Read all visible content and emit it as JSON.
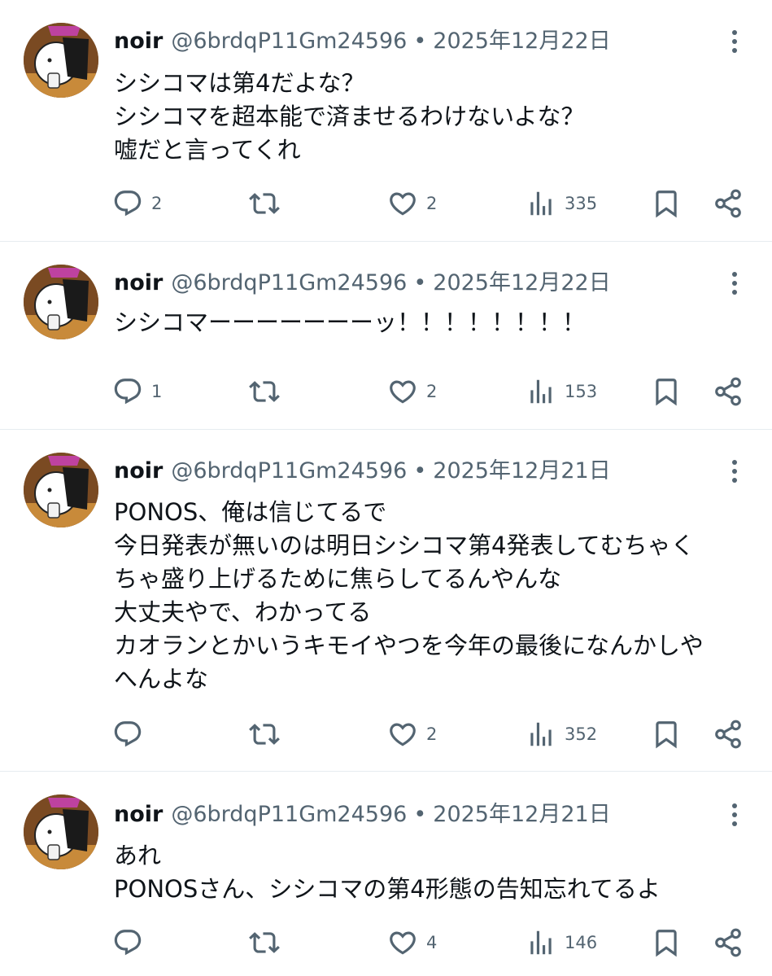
{
  "tweets": [
    {
      "name": "noir",
      "handle": "@6brdqP11Gm24596",
      "separator": "•",
      "date": "2025年12月22日",
      "lines": [
        "シシコマは第4だよな？",
        "シシコマを超本能で済ませるわけないよな？",
        "嘘だと言ってくれ"
      ],
      "replies": "2",
      "retweets": "",
      "likes": "2",
      "views": "335"
    },
    {
      "name": "noir",
      "handle": "@6brdqP11Gm24596",
      "separator": "•",
      "date": "2025年12月22日",
      "lines": [
        "シシコマーーーーーーーッ！！！！！！！！"
      ],
      "replies": "1",
      "retweets": "",
      "likes": "2",
      "views": "153"
    },
    {
      "name": "noir",
      "handle": "@6brdqP11Gm24596",
      "separator": "•",
      "date": "2025年12月21日",
      "lines": [
        "PONOS、俺は信じてるで",
        "今日発表が無いのは明日シシコマ第4発表してむちゃく",
        "ちゃ盛り上げるために焦らしてるんやんな",
        "大丈夫やで、わかってる",
        "カオランとかいうキモイやつを今年の最後になんかしや",
        "へんよな"
      ],
      "replies": "",
      "retweets": "",
      "likes": "2",
      "views": "352"
    },
    {
      "name": "noir",
      "handle": "@6brdqP11Gm24596",
      "separator": "•",
      "date": "2025年12月21日",
      "lines": [
        "あれ",
        "PONOSさん、シシコマの第4形態の告知忘れてるよ"
      ],
      "replies": "",
      "retweets": "",
      "likes": "4",
      "views": "146"
    }
  ]
}
